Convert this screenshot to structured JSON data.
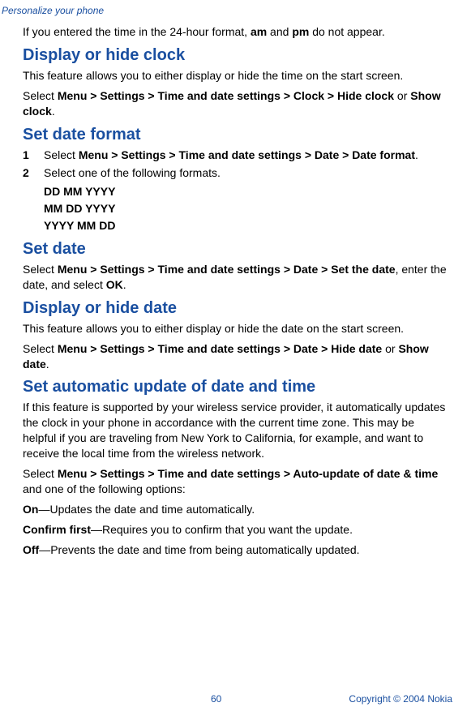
{
  "header": {
    "label": "Personalize your phone"
  },
  "intro": {
    "text_a": "If you entered the time in the 24-hour format, ",
    "bold_am": "am",
    "text_b": " and ",
    "bold_pm": "pm",
    "text_c": " do not appear."
  },
  "s1": {
    "heading": "Display or hide clock",
    "desc": "This feature allows you to either display or hide the time on the start screen.",
    "sel_a": "Select ",
    "sel_b": "Menu > Settings > Time and date settings > Clock > Hide clock",
    "sel_c": " or ",
    "sel_d": "Show clock",
    "sel_e": "."
  },
  "s2": {
    "heading": "Set date format",
    "step1_num": "1",
    "step1_a": "Select ",
    "step1_b": "Menu > Settings > Time and date settings > Date > Date format",
    "step1_c": ".",
    "step2_num": "2",
    "step2_a": "Select one of the following formats.",
    "fmt1": "DD MM YYYY",
    "fmt2": "MM DD YYYY",
    "fmt3": "YYYY MM DD"
  },
  "s3": {
    "heading": "Set date",
    "a": "Select ",
    "b": "Menu > Settings > Time and date settings > Date > Set the date",
    "c": ", enter the date, and select ",
    "d": "OK",
    "e": "."
  },
  "s4": {
    "heading": "Display or hide date",
    "desc": "This feature allows you to either display or hide the date on the start screen.",
    "sel_a": "Select ",
    "sel_b": "Menu > Settings > Time and date settings > Date > Hide date",
    "sel_c": " or ",
    "sel_d": "Show date",
    "sel_e": "."
  },
  "s5": {
    "heading": "Set automatic update of date and time",
    "desc": "If this feature is supported by your wireless service provider, it automatically updates the clock in your phone in accordance with the current time zone. This may be helpful if you are traveling from New York to California, for example, and want to receive the local time from the wireless network.",
    "sel_a": "Select ",
    "sel_b": "Menu > Settings > Time and date settings > Auto-update of date & time",
    "sel_c": " and one of the following options:",
    "opt1_b": "On",
    "opt1_t": "—Updates the date and time automatically.",
    "opt2_b": "Confirm first",
    "opt2_t": "—Requires you to confirm that you want the update.",
    "opt3_b": "Off",
    "opt3_t": "—Prevents the date and time from being automatically updated."
  },
  "footer": {
    "page": "60",
    "copyright": "Copyright © 2004 Nokia"
  }
}
